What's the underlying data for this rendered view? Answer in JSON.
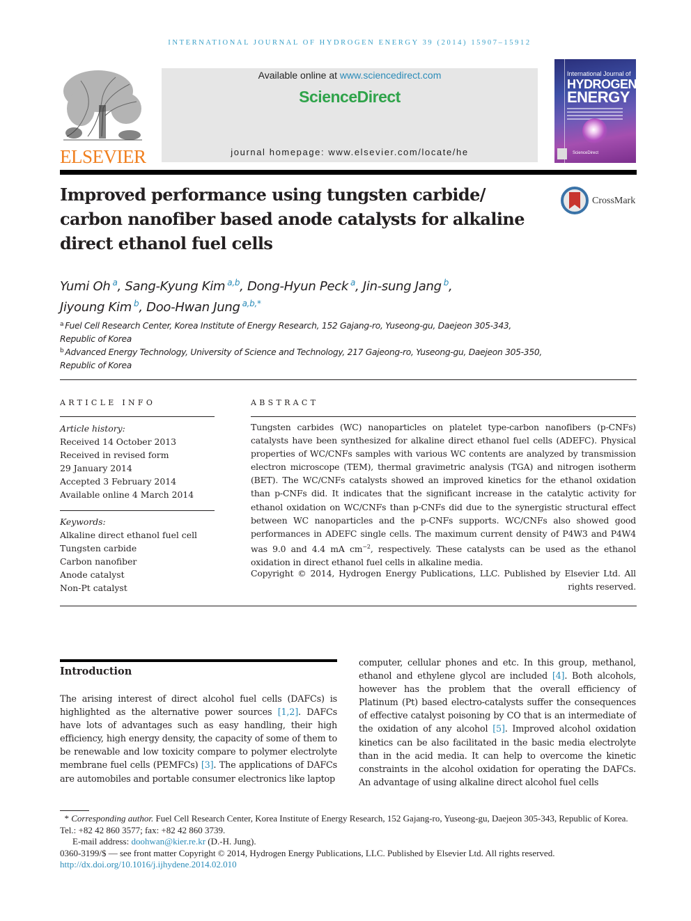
{
  "running_head": "INTERNATIONAL JOURNAL OF HYDROGEN ENERGY 39 (2014) 15907–15912",
  "header": {
    "publisher": "ELSEVIER",
    "available_prefix": "Available online at ",
    "available_link": "www.sciencedirect.com",
    "platform": "ScienceDirect",
    "homepage": "journal homepage: www.elsevier.com/locate/he",
    "cover": {
      "line1": "International Journal of",
      "line2": "HYDROGEN",
      "line3": "ENERGY",
      "footer": "ScienceDirect"
    }
  },
  "colors": {
    "link": "#2a8bb8",
    "sciencedirect_green": "#2fa34a",
    "elsevier_orange": "#f07f1e",
    "running_head": "#3aa0c8"
  },
  "article": {
    "title": "Improved performance using tungsten carbide/ carbon nanofiber based anode catalysts for alkaline direct ethanol fuel cells",
    "crossmark": "CrossMark",
    "authors": [
      {
        "name": "Yumi Oh",
        "aff": "a",
        "sep": ", "
      },
      {
        "name": "Sang-Kyung Kim",
        "aff": "a,b",
        "sep": ", "
      },
      {
        "name": "Dong-Hyun Peck",
        "aff": "a",
        "sep": ", "
      },
      {
        "name": "Jin-sung Jang",
        "aff": "b",
        "sep": ","
      },
      {
        "name": "Jiyoung Kim",
        "aff": "b",
        "sep": ", "
      },
      {
        "name": "Doo-Hwan Jung",
        "aff": "a,b,*",
        "sep": ""
      }
    ],
    "affiliations": [
      {
        "mark": "a",
        "text": "Fuel Cell Research Center, Korea Institute of Energy Research, 152 Gajang-ro, Yuseong-gu, Daejeon 305-343, Republic of Korea"
      },
      {
        "mark": "b",
        "text": "Advanced Energy Technology, University of Science and Technology, 217 Gajeong-ro, Yuseong-gu, Daejeon 305-350, Republic of Korea"
      }
    ]
  },
  "article_info": {
    "heading": "ARTICLE INFO",
    "history_label": "Article history:",
    "history": [
      "Received 14 October 2013",
      "Received in revised form",
      "29 January 2014",
      "Accepted 3 February 2014",
      "Available online 4 March 2014"
    ],
    "keywords_label": "Keywords:",
    "keywords": [
      "Alkaline direct ethanol fuel cell",
      "Tungsten carbide",
      "Carbon nanofiber",
      "Anode catalyst",
      "Non-Pt catalyst"
    ]
  },
  "abstract": {
    "heading": "ABSTRACT",
    "text_before_sup": "Tungsten carbides (WC) nanoparticles on platelet type-carbon nanofibers (p-CNFs) catalysts have been synthesized for alkaline direct ethanol fuel cells (ADEFC). Physical properties of WC/CNFs samples with various WC contents are analyzed by transmission electron microscope (TEM), thermal gravimetric analysis (TGA) and nitrogen isotherm (BET). The WC/CNFs catalysts showed an improved kinetics for the ethanol oxidation than p-CNFs did. It indicates that the significant increase in the catalytic activity for ethanol oxidation on WC/CNFs than p-CNFs did due to the synergistic structural effect between WC nanoparticles and the p-CNFs supports. WC/CNFs also showed good performances in ADEFC single cells. The maximum current density of P4W3 and P4W4 was 9.0 and 4.4 mA cm",
    "sup": "−2",
    "text_after_sup": ", respectively. These catalysts can be used as the ethanol oxidation in direct ethanol fuel cells in alkaline media.",
    "copyright": "Copyright © 2014, Hydrogen Energy Publications, LLC. Published by Elsevier Ltd. All rights reserved."
  },
  "introduction": {
    "heading": "Introduction",
    "left": {
      "p1": "The arising interest of direct alcohol fuel cells (DAFCs) is highlighted as the alternative power sources ",
      "ref1": "[1,2]",
      "p2": ". DAFCs have lots of advantages such as easy handling, their high efficiency, high energy density, the capacity of some of them to be renewable and low toxicity compare to polymer electrolyte membrane fuel cells (PEMFCs) ",
      "ref2": "[3]",
      "p3": ". The applications of DAFCs are automobiles and portable consumer electronics like laptop"
    },
    "right": {
      "p1": "computer, cellular phones and etc. In this group, methanol, ethanol and ethylene glycol are included ",
      "ref1": "[4]",
      "p2": ". Both alcohols, however has the problem that the overall efficiency of Platinum (Pt) based electro-catalysts suffer the consequences of effective catalyst poisoning by CO that is an intermediate of the oxidation of any alcohol ",
      "ref2": "[5]",
      "p3": ". Improved alcohol oxidation kinetics can be also facilitated in the basic media electrolyte than in the acid media. It can help to overcome the kinetic constraints in the alcohol oxidation for operating the DAFCs. An advantage of using alkaline direct alcohol fuel cells"
    }
  },
  "footnotes": {
    "star": "*",
    "corr_label": "Corresponding author.",
    "corr_text": " Fuel Cell Research Center, Korea Institute of Energy Research, 152 Gajang-ro, Yuseong-gu, Daejeon 305-343, Republic of Korea. Tel.: +82 42 860 3577; fax: +82 42 860 3739.",
    "email_label": "E-mail address: ",
    "email": "doohwan@kier.re.kr",
    "email_suffix": " (D.-H. Jung).",
    "issn_line": "0360-3199/$ — see front matter Copyright © 2014, Hydrogen Energy Publications, LLC. Published by Elsevier Ltd. All rights reserved.",
    "doi": "http://dx.doi.org/10.1016/j.ijhydene.2014.02.010"
  }
}
